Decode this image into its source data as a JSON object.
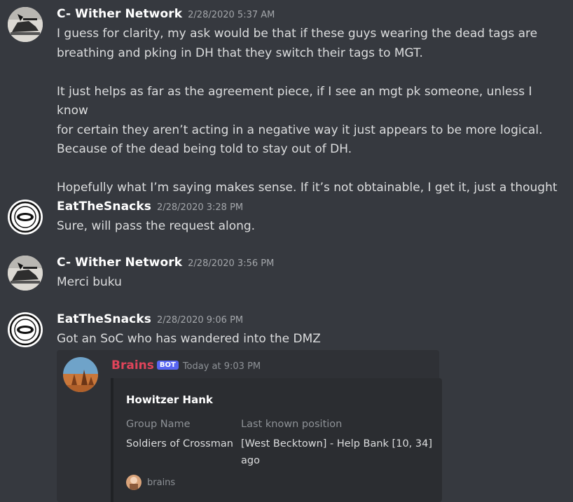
{
  "messages": [
    {
      "author": "C- Wither Network",
      "timestamp": "2/28/2020 5:37 AM",
      "lines": [
        "I guess for clarity, my ask would be that if these guys wearing the dead tags are",
        "breathing and pking in DH that they switch their tags to MGT.",
        "",
        "It just helps as far as the agreement piece, if I see an mgt pk someone, unless I know",
        "for certain they aren’t acting in a negative way it just appears to be more logical.",
        "Because of the dead being told to stay out of DH.",
        "",
        "Hopefully what I’m saying makes sense. If it’s not obtainable, I get it, just a thought"
      ]
    },
    {
      "author": "EatTheSnacks",
      "timestamp": "2/28/2020 3:28 PM",
      "text": "Sure, will pass the request along."
    },
    {
      "author": "C- Wither Network",
      "timestamp": "2/28/2020 3:56 PM",
      "text": "Merci buku"
    },
    {
      "author": "EatTheSnacks",
      "timestamp": "2/28/2020 9:06 PM",
      "text": "Got an SoC who has wandered into the DMZ"
    }
  ],
  "bot_message": {
    "name": "Brains",
    "tag": "BOT",
    "timestamp": "Today at 9:03 PM",
    "embed": {
      "title": "Howitzer Hank",
      "field1_name": "Group Name",
      "field1_value": "Soldiers of Crossman",
      "field2_name": "Last known position",
      "field2_value_line1": "[West Becktown] - Help Bank [10, 34]",
      "field2_value_line2": "ago",
      "footer_text": "brains"
    }
  },
  "icons": {
    "wither_avatar": "tank-on-snow-avatar",
    "snacks_avatar": "round-seal-avatar",
    "brains_avatar": "desert-rocks-avatar"
  },
  "colors": {
    "background": "#36393f",
    "bot_name": "#e0445a",
    "bot_tag": "#5865f2"
  }
}
